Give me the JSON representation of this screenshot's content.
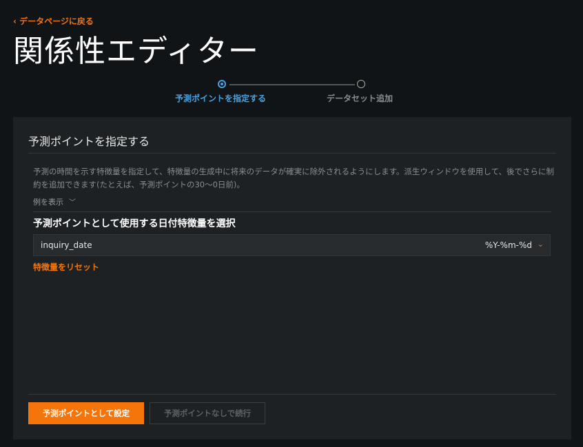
{
  "header": {
    "back_link": "データページに戻る",
    "title": "関係性エディター"
  },
  "stepper": {
    "steps": [
      {
        "label": "予測ポイントを指定する",
        "state": "active"
      },
      {
        "label": "データセット追加",
        "state": "pending"
      }
    ]
  },
  "panel": {
    "title": "予測ポイントを指定する",
    "description": "予測の時間を示す特徴量を指定して、特徴量の生成中に将来のデータが確実に除外されるようにします。派生ウィンドウを使用して、後でさらに制約を追加できます(たとえば、予測ポイントの30〜0日前)。",
    "show_examples": "例を表示",
    "select_label": "予測ポイントとして使用する日付特徴量を選択",
    "select_value": "inquiry_date",
    "select_format": "%Y-%m-%d",
    "reset_link": "特徴量をリセット",
    "primary_button": "予測ポイントとして設定",
    "secondary_button": "予測ポイントなしで続行"
  },
  "colors": {
    "accent": "#f5750a",
    "step_active": "#4aa3df",
    "background": "#101416",
    "panel": "#1d2124"
  }
}
